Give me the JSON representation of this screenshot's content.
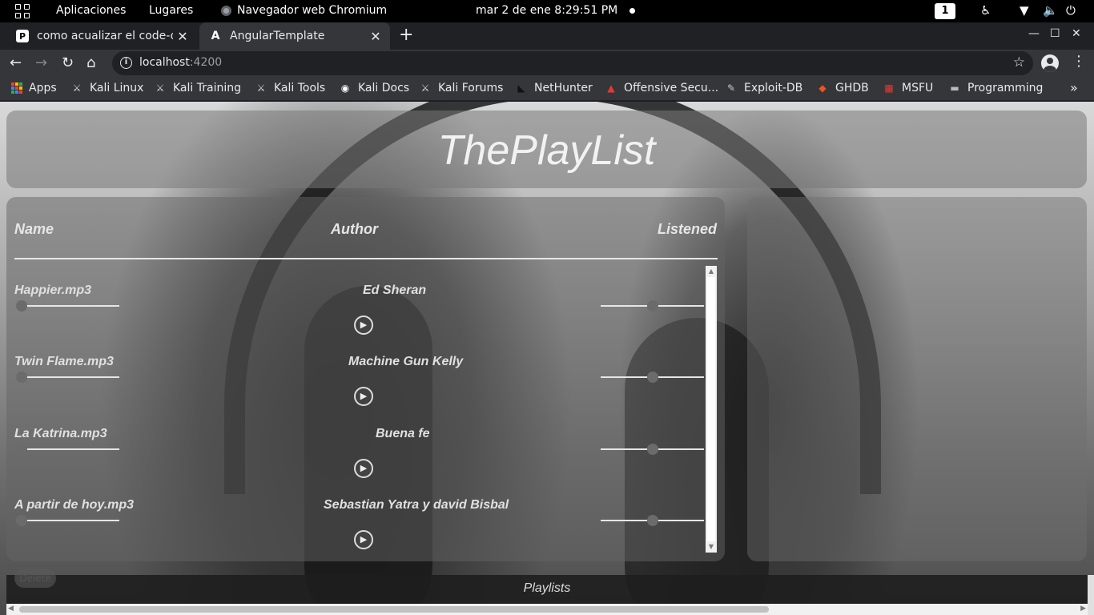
{
  "system_bar": {
    "activities_label": "Aplicaciones",
    "places_label": "Lugares",
    "app_label": "Navegador web Chromium",
    "clock": "mar  2 de ene   8:29:51 PM",
    "workspace": "1"
  },
  "tabs": [
    {
      "favicon": "P",
      "title": "como acualizar el code-os",
      "close": "✕"
    },
    {
      "favicon": "A",
      "title": "AngularTemplate",
      "close": "✕"
    }
  ],
  "new_tab": "+",
  "window_controls": {
    "minimize": "—",
    "maximize": "☐",
    "close": "✕"
  },
  "toolbar": {
    "back": "←",
    "forward": "→",
    "reload": "↻",
    "home": "⌂",
    "url_host": "localhost",
    "url_port": ":4200",
    "star": "☆",
    "menu": "⋮"
  },
  "bookmarks": [
    {
      "label": "Apps",
      "icon": "apps-grid-icon"
    },
    {
      "label": "Kali Linux",
      "icon": "kali-dragon-icon"
    },
    {
      "label": "Kali Training",
      "icon": "kali-dragon-icon"
    },
    {
      "label": "Kali Tools",
      "icon": "kali-dragon-icon"
    },
    {
      "label": "Kali Docs",
      "icon": "kali-docs-icon"
    },
    {
      "label": "Kali Forums",
      "icon": "kali-dragon-icon"
    },
    {
      "label": "NetHunter",
      "icon": "nethunter-icon"
    },
    {
      "label": "Offensive Secu...",
      "icon": "offsec-icon"
    },
    {
      "label": "Exploit-DB",
      "icon": "exploitdb-icon"
    },
    {
      "label": "GHDB",
      "icon": "ghdb-icon"
    },
    {
      "label": "MSFU",
      "icon": "msfu-icon"
    },
    {
      "label": "Programming",
      "icon": "folder-icon"
    }
  ],
  "bookmarks_more": "»",
  "app": {
    "title": "ThePlayList",
    "columns": {
      "name": "Name",
      "author": "Author",
      "listened": "Listened"
    },
    "songs": [
      {
        "name": "Happier.mp3",
        "author": "Ed Sheran",
        "listened": "0",
        "progress": 0,
        "volume": 0.5
      },
      {
        "name": "Twin Flame.mp3",
        "author": "Machine Gun Kelly",
        "listened": "0",
        "progress": 0,
        "volume": 0.5
      },
      {
        "name": "La Katrina.mp3",
        "author": "Buena fe",
        "listened": "0",
        "progress": 0,
        "volume": 0.5
      },
      {
        "name": "A partir de hoy.mp3",
        "author": "Sebastian Yatra y david Bisbal",
        "listened": "0",
        "progress": 0,
        "volume": 0.5
      }
    ],
    "play_symbol": "▶",
    "delete_label": "Delete",
    "footer_label": "Playlists"
  },
  "colors": {
    "accent": "#e6e6e6",
    "card": "#787878"
  }
}
